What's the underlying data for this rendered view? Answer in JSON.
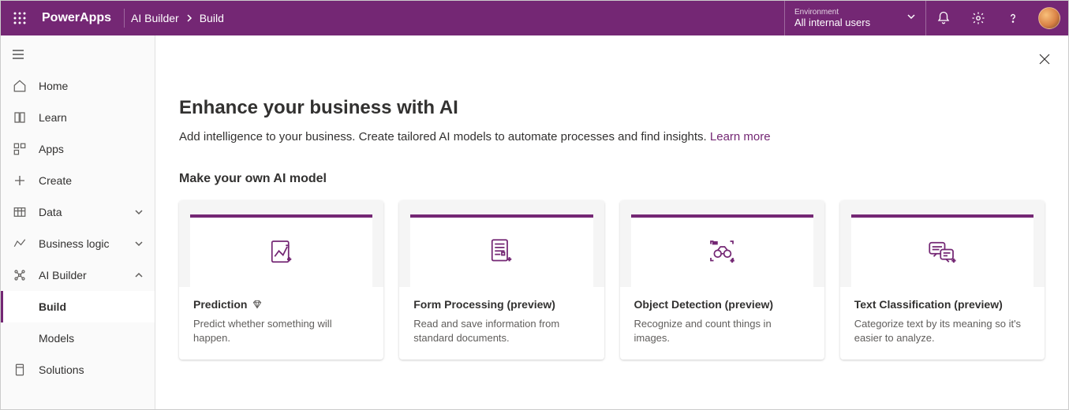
{
  "header": {
    "brand": "PowerApps",
    "breadcrumb": [
      "AI Builder",
      "Build"
    ],
    "environment_label": "Environment",
    "environment_value": "All internal users"
  },
  "sidebar": {
    "items": [
      {
        "id": "home",
        "label": "Home"
      },
      {
        "id": "learn",
        "label": "Learn"
      },
      {
        "id": "apps",
        "label": "Apps"
      },
      {
        "id": "create",
        "label": "Create"
      },
      {
        "id": "data",
        "label": "Data",
        "expandable": true
      },
      {
        "id": "businesslogic",
        "label": "Business logic",
        "expandable": true
      },
      {
        "id": "aibuilder",
        "label": "AI Builder",
        "expandable": true,
        "expanded": true,
        "children": [
          {
            "id": "build",
            "label": "Build",
            "active": true
          },
          {
            "id": "models",
            "label": "Models"
          }
        ]
      },
      {
        "id": "solutions",
        "label": "Solutions"
      }
    ]
  },
  "main": {
    "title": "Enhance your business with AI",
    "subtitle": "Add intelligence to your business. Create tailored AI models to automate processes and find insights.",
    "learn_more": "Learn more",
    "section_heading": "Make your own AI model",
    "cards": [
      {
        "id": "prediction",
        "title": "Prediction",
        "premium": true,
        "desc": "Predict whether something will happen."
      },
      {
        "id": "form",
        "title": "Form Processing (preview)",
        "desc": "Read and save information from standard documents."
      },
      {
        "id": "object",
        "title": "Object Detection (preview)",
        "desc": "Recognize and count things in images."
      },
      {
        "id": "text",
        "title": "Text Classification (preview)",
        "desc": "Categorize text by its meaning so it's easier to analyze."
      }
    ]
  }
}
